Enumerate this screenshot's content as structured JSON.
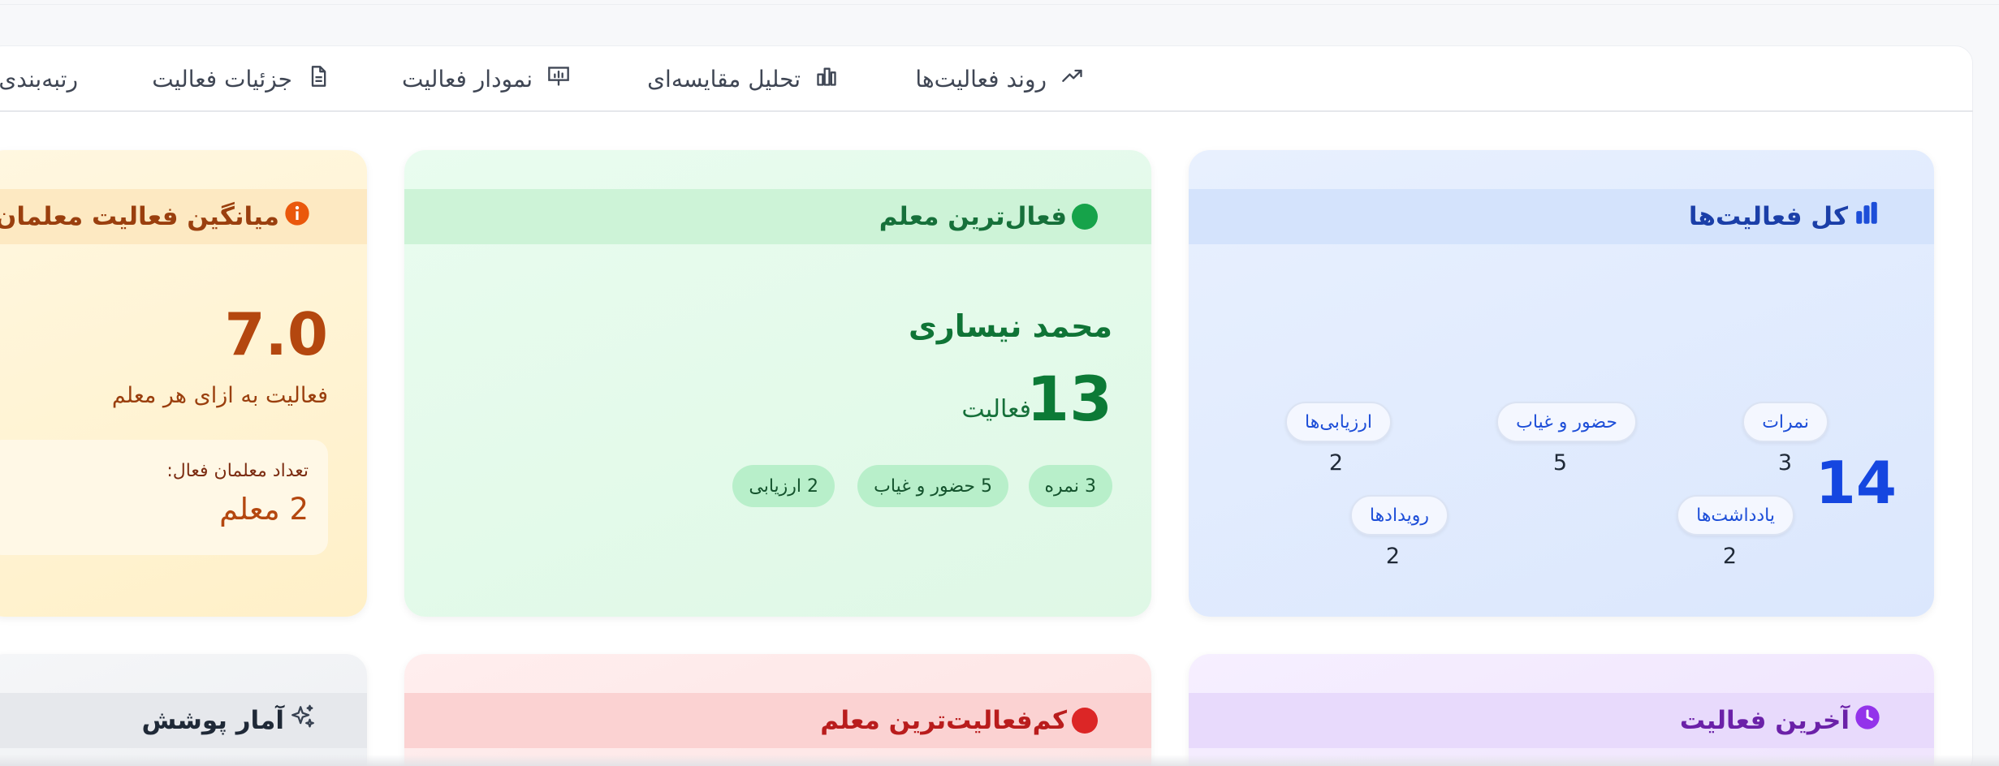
{
  "tabs": [
    {
      "label": "روند فعالیت‌ها",
      "icon": "trending-up-icon"
    },
    {
      "label": "تحلیل مقایسه‌ای",
      "icon": "bar-compare-icon"
    },
    {
      "label": "نمودار فعالیت",
      "icon": "presentation-chart-icon"
    },
    {
      "label": "جزئیات فعالیت",
      "icon": "document-icon"
    },
    {
      "label": "رتبه‌بندی مع",
      "icon": ""
    }
  ],
  "cards": {
    "total": {
      "title": "کل فعالیت‌ها",
      "value": "14",
      "color": "#1546e0",
      "breakdown": [
        {
          "label": "نمرات",
          "value": "3"
        },
        {
          "label": "حضور و غیاب",
          "value": "5"
        },
        {
          "label": "ارزیابی‌ها",
          "value": "2"
        },
        {
          "label": "یادداشت‌ها",
          "value": "2"
        },
        {
          "label": "رویدادها",
          "value": "2"
        }
      ]
    },
    "most_active": {
      "title": "فعال‌ترین معلم",
      "name": "محمد نیساری",
      "count": "13",
      "unit": "فعالیت",
      "color": "#16a34a",
      "pills": [
        "3 نمره",
        "5 حضور و غیاب",
        "2 ارزیابی"
      ]
    },
    "average": {
      "title": "میانگین فعالیت معلمان",
      "value": "7.0",
      "caption": "فعالیت به ازای هر معلم",
      "active_label": "تعداد معلمان فعال:",
      "active_value": "2 معلم",
      "color": "#ea580c"
    },
    "last_activity": {
      "title": "آخرین فعالیت",
      "color": "#9333ea"
    },
    "least_active": {
      "title": "کم‌فعالیت‌ترین معلم",
      "color": "#dc2626"
    },
    "coverage": {
      "title": "آمار پوشش"
    }
  }
}
